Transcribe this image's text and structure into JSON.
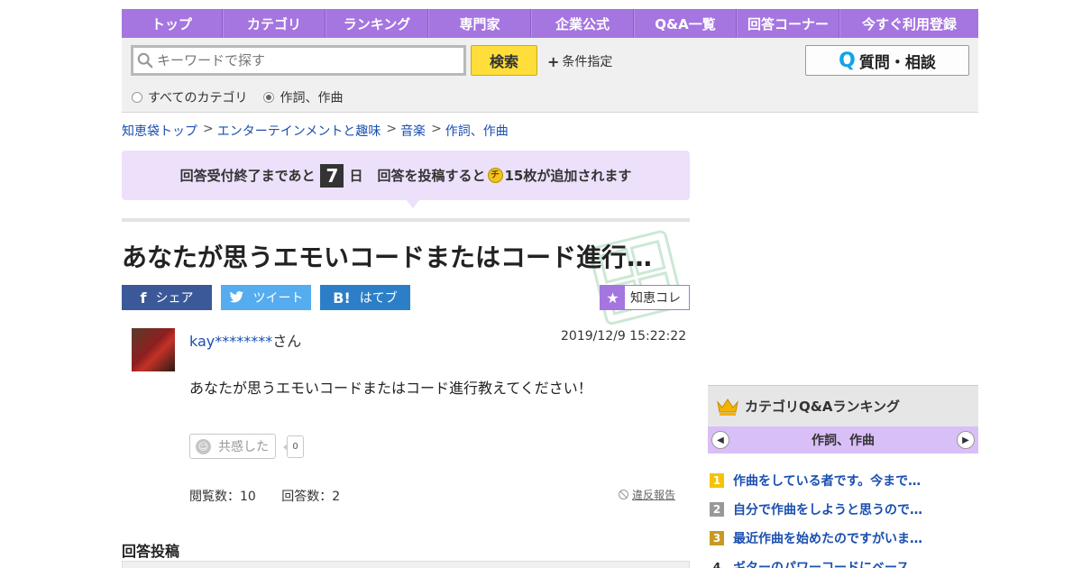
{
  "nav": {
    "items": [
      "トップ",
      "カテゴリ",
      "ランキング",
      "専門家",
      "企業公式",
      "Q&A一覧",
      "回答コーナー",
      "今すぐ利用登録"
    ]
  },
  "search": {
    "placeholder": "キーワードで探す",
    "button": "検索",
    "condition": "条件指定",
    "ask_button": "質問・相談",
    "ask_q": "Q",
    "radios": [
      {
        "label": "すべてのカテゴリ",
        "checked": false
      },
      {
        "label": "作詞、作曲",
        "checked": true
      }
    ]
  },
  "breadcrumb": [
    "知恵袋トップ",
    "エンターテインメントと趣味",
    "音楽",
    "作詞、作曲"
  ],
  "breadcrumb_sep": ">",
  "notice": {
    "pre": "回答受付終了まであと",
    "days": "7",
    "unit": "日",
    "post1": "回答を投稿すると",
    "coin": "チ",
    "post2": "15枚が追加されます"
  },
  "question": {
    "title": "あなたが思うエモいコードまたはコード進行…",
    "share": {
      "facebook": "シェア",
      "twitter": "ツイート",
      "hatena": "はてブ"
    },
    "chiecolle": "知恵コレ",
    "user": "kay********",
    "user_suffix": "さん",
    "date": "2019/12/9  15:22:22",
    "body": "あなたが思うエモいコードまたはコード進行教えてください！",
    "empathy_label": "共感した",
    "empathy_count": "0",
    "views": "閲覧数：10",
    "answers": "回答数：2",
    "report": "違反報告"
  },
  "answer_heading": "回答投稿",
  "ranking": {
    "title": "カテゴリQ&Aランキング",
    "category": "作詞、作曲",
    "items": [
      {
        "rank": "1",
        "text": "作曲をしている者です。今まで…",
        "color": "#f5c400"
      },
      {
        "rank": "2",
        "text": "自分で作曲をしようと思うので…",
        "color": "#999999"
      },
      {
        "rank": "3",
        "text": "最近作曲を始めたのですがいま…",
        "color": "#c89a22"
      },
      {
        "rank": "4",
        "text": "ギターのパワーコードにベース…",
        "color": ""
      }
    ]
  },
  "colors": {
    "nav": "#a575e0",
    "accent": "#ffde3b",
    "link": "#1a4fb0"
  }
}
